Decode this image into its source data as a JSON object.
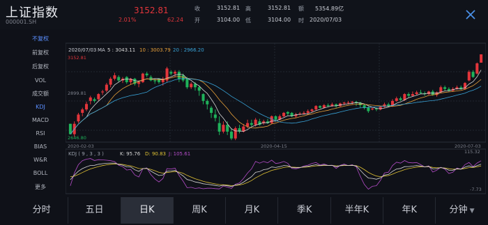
{
  "header": {
    "title": "上证指数",
    "code": "000001.SH",
    "price": "3152.81",
    "change_pct": "2.01%",
    "change": "62.24",
    "quotes": [
      {
        "label": "收",
        "value": "3152.81"
      },
      {
        "label": "开",
        "value": "3104.00"
      },
      {
        "label": "高",
        "value": "3152.81"
      },
      {
        "label": "低",
        "value": "3104.00"
      },
      {
        "label": "额",
        "value": "5354.89亿"
      },
      {
        "label": "时",
        "value": "2020/07/03"
      }
    ]
  },
  "sidebar": {
    "items": [
      {
        "label": "不复权"
      },
      {
        "label": "前复权"
      },
      {
        "label": "后复权"
      },
      {
        "label": "VOL"
      },
      {
        "label": "成交额"
      },
      {
        "label": "KDJ"
      },
      {
        "label": "MACD"
      },
      {
        "label": "RSI"
      },
      {
        "label": "BIAS"
      },
      {
        "label": "W&R"
      },
      {
        "label": "BOLL"
      },
      {
        "label": "更多"
      }
    ],
    "active": "不复权"
  },
  "main_chart": {
    "date": "2020/07/03",
    "ma_label": "MA",
    "ma5": "5 : 3043.11",
    "ma10": "10 : 3003.79",
    "ma20": "20 : 2966.20",
    "high_label": "3152.81",
    "mid_label": "2899.81",
    "low_label": "2646.80",
    "x_labels": [
      "2020-02-03",
      "2020-04-15",
      "2020-07-03"
    ]
  },
  "kdj_chart": {
    "params": "KDJ ( 9 , 3 , 3 )",
    "k": "K: 95.76",
    "d": "D: 90.83",
    "j": "J: 105.61",
    "max_label": "115.32",
    "min_label": "-7.73"
  },
  "colors": {
    "up": "#e3353b",
    "down": "#1fb25a",
    "ma5": "#d7d7d7",
    "ma10": "#e8a13a",
    "ma20": "#38a3d8",
    "kdj_k": "#d7d7d7",
    "kdj_d": "#e0c234",
    "kdj_j": "#b44cc8",
    "accent": "#5b8fff"
  },
  "tabs": [
    {
      "label": "分时"
    },
    {
      "label": "五日"
    },
    {
      "label": "日K"
    },
    {
      "label": "周K"
    },
    {
      "label": "月K"
    },
    {
      "label": "季K"
    },
    {
      "label": "半年K"
    },
    {
      "label": "年K"
    },
    {
      "label": "分钟"
    }
  ],
  "active_tab": "日K",
  "chart_data": {
    "type": "candlestick",
    "x_range": [
      "2020-02-03",
      "2020-07-03"
    ],
    "y_range": [
      2646.8,
      3152.81
    ],
    "candles": [
      [
        2746,
        2685,
        2746,
        2685
      ],
      [
        2685,
        2746,
        2760,
        2670
      ],
      [
        2760,
        2800,
        2810,
        2750
      ],
      [
        2810,
        2830,
        2840,
        2790
      ],
      [
        2830,
        2862,
        2875,
        2820
      ],
      [
        2880,
        2900,
        2910,
        2860
      ],
      [
        2890,
        2880,
        2900,
        2870
      ],
      [
        2890,
        2920,
        2925,
        2880
      ],
      [
        2930,
        2935,
        2945,
        2915
      ],
      [
        2940,
        2975,
        2985,
        2930
      ],
      [
        2975,
        3010,
        3020,
        2960
      ],
      [
        3010,
        3030,
        3045,
        3000
      ],
      [
        3020,
        3000,
        3030,
        2990
      ],
      [
        3000,
        3010,
        3020,
        2985
      ],
      [
        3020,
        2990,
        3025,
        2980
      ],
      [
        2990,
        3010,
        3015,
        2975
      ],
      [
        3010,
        2980,
        3015,
        2970
      ],
      [
        2980,
        2990,
        3000,
        2960
      ],
      [
        2990,
        3040,
        3045,
        2985
      ],
      [
        3040,
        3030,
        3050,
        3020
      ],
      [
        3020,
        3000,
        3030,
        2995
      ],
      [
        3000,
        2995,
        3010,
        2980
      ],
      [
        3010,
        2990,
        3010,
        2980
      ],
      [
        2990,
        3010,
        3020,
        2970
      ],
      [
        3000,
        3070,
        3080,
        2990
      ],
      [
        3050,
        3040,
        3060,
        3030
      ],
      [
        3040,
        3050,
        3060,
        3020
      ],
      [
        3050,
        3010,
        3060,
        2990
      ],
      [
        3030,
        3000,
        3040,
        2990
      ],
      [
        3010,
        2960,
        3020,
        2950
      ],
      [
        2960,
        2980,
        2990,
        2950
      ],
      [
        2980,
        2960,
        2990,
        2940
      ],
      [
        2960,
        2940,
        2970,
        2910
      ],
      [
        2920,
        2880,
        2925,
        2860
      ],
      [
        2880,
        2860,
        2890,
        2830
      ],
      [
        2840,
        2810,
        2850,
        2780
      ],
      [
        2800,
        2780,
        2830,
        2760
      ],
      [
        2750,
        2700,
        2790,
        2680
      ],
      [
        2700,
        2740,
        2760,
        2690
      ],
      [
        2740,
        2700,
        2760,
        2680
      ],
      [
        2700,
        2660,
        2720,
        2650
      ],
      [
        2660,
        2720,
        2730,
        2650
      ],
      [
        2720,
        2700,
        2740,
        2690
      ],
      [
        2700,
        2730,
        2745,
        2695
      ],
      [
        2730,
        2750,
        2770,
        2720
      ],
      [
        2750,
        2740,
        2770,
        2730
      ],
      [
        2740,
        2770,
        2780,
        2730
      ],
      [
        2760,
        2740,
        2775,
        2735
      ],
      [
        2750,
        2760,
        2770,
        2740
      ],
      [
        2760,
        2750,
        2775,
        2745
      ],
      [
        2750,
        2790,
        2795,
        2745
      ],
      [
        2790,
        2770,
        2795,
        2760
      ],
      [
        2770,
        2790,
        2800,
        2765
      ],
      [
        2790,
        2810,
        2815,
        2785
      ],
      [
        2815,
        2805,
        2820,
        2795
      ],
      [
        2810,
        2790,
        2815,
        2785
      ],
      [
        2790,
        2800,
        2810,
        2780
      ],
      [
        2800,
        2805,
        2815,
        2795
      ],
      [
        2805,
        2810,
        2820,
        2800
      ],
      [
        2810,
        2820,
        2830,
        2800
      ],
      [
        2820,
        2830,
        2835,
        2815
      ],
      [
        2830,
        2850,
        2855,
        2825
      ],
      [
        2850,
        2840,
        2855,
        2835
      ],
      [
        2840,
        2855,
        2862,
        2835
      ],
      [
        2855,
        2850,
        2865,
        2845
      ],
      [
        2850,
        2860,
        2870,
        2845
      ],
      [
        2860,
        2850,
        2865,
        2840
      ],
      [
        2850,
        2865,
        2870,
        2845
      ],
      [
        2865,
        2870,
        2875,
        2855
      ],
      [
        2870,
        2870,
        2880,
        2860
      ],
      [
        2870,
        2875,
        2880,
        2860
      ],
      [
        2875,
        2870,
        2880,
        2850
      ],
      [
        2870,
        2855,
        2875,
        2840
      ],
      [
        2855,
        2840,
        2860,
        2830
      ],
      [
        2840,
        2820,
        2850,
        2810
      ],
      [
        2830,
        2835,
        2845,
        2825
      ],
      [
        2835,
        2830,
        2840,
        2820
      ],
      [
        2830,
        2845,
        2850,
        2825
      ],
      [
        2845,
        2860,
        2870,
        2840
      ],
      [
        2860,
        2850,
        2870,
        2845
      ],
      [
        2850,
        2880,
        2890,
        2845
      ],
      [
        2880,
        2895,
        2905,
        2875
      ],
      [
        2895,
        2885,
        2905,
        2880
      ],
      [
        2885,
        2920,
        2925,
        2880
      ],
      [
        2920,
        2910,
        2930,
        2900
      ],
      [
        2910,
        2920,
        2935,
        2905
      ],
      [
        2920,
        2930,
        2940,
        2915
      ],
      [
        2930,
        2925,
        2945,
        2920
      ],
      [
        2925,
        2920,
        2935,
        2910
      ],
      [
        2920,
        2935,
        2940,
        2915
      ],
      [
        2935,
        2915,
        2945,
        2910
      ],
      [
        2915,
        2930,
        2935,
        2905
      ],
      [
        2930,
        2960,
        2970,
        2925
      ],
      [
        2960,
        2950,
        2970,
        2940
      ],
      [
        2950,
        2940,
        2960,
        2935
      ],
      [
        2940,
        2950,
        2960,
        2935
      ],
      [
        2950,
        2960,
        2970,
        2945
      ],
      [
        2960,
        2950,
        2970,
        2945
      ],
      [
        2950,
        2985,
        2990,
        2945
      ],
      [
        3000,
        3050,
        3060,
        2995
      ],
      [
        3050,
        3020,
        3060,
        3015
      ],
      [
        3040,
        3100,
        3105,
        3035
      ],
      [
        3104,
        3152.81,
        3152.81,
        3104
      ]
    ]
  }
}
